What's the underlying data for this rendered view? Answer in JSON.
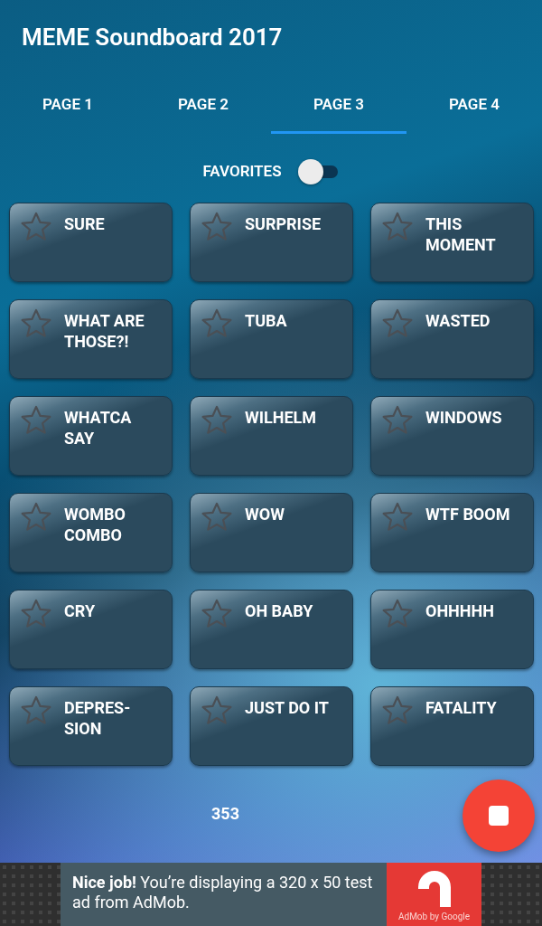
{
  "app_bar": {
    "title": "MEME Soundboard 2017"
  },
  "tabs": [
    {
      "label": "PAGE 1",
      "selected": false
    },
    {
      "label": "PAGE 2",
      "selected": false
    },
    {
      "label": "PAGE 3",
      "selected": true
    },
    {
      "label": "PAGE 4",
      "selected": false
    }
  ],
  "favorites_toggle": {
    "label": "FAVORITES",
    "on": false
  },
  "sounds": [
    {
      "label": "SURE",
      "favorite": false
    },
    {
      "label": "SURPRISE",
      "favorite": false
    },
    {
      "label": "THIS MOMENT",
      "favorite": false
    },
    {
      "label": "WHAT ARE THOSE?!",
      "favorite": false
    },
    {
      "label": "TUBA",
      "favorite": false
    },
    {
      "label": "WASTED",
      "favorite": false
    },
    {
      "label": "WHATCA SAY",
      "favorite": false
    },
    {
      "label": "WILHELM",
      "favorite": false
    },
    {
      "label": "WINDOWS",
      "favorite": false
    },
    {
      "label": "WOMBO COMBO",
      "favorite": false
    },
    {
      "label": "WOW",
      "favorite": false
    },
    {
      "label": "WTF BOOM",
      "favorite": false
    },
    {
      "label": "CRY",
      "favorite": false
    },
    {
      "label": "OH BABY",
      "favorite": false
    },
    {
      "label": "OHHHHH",
      "favorite": false
    },
    {
      "label": "DEPRES-SION",
      "favorite": false
    },
    {
      "label": "JUST DO IT",
      "favorite": false
    },
    {
      "label": "FATALITY",
      "favorite": false
    }
  ],
  "count": "353",
  "ad": {
    "text": "**Nice job!** You’re displaying a 320 x 50 test ad from AdMob.",
    "brand": "AdMob by Google"
  }
}
